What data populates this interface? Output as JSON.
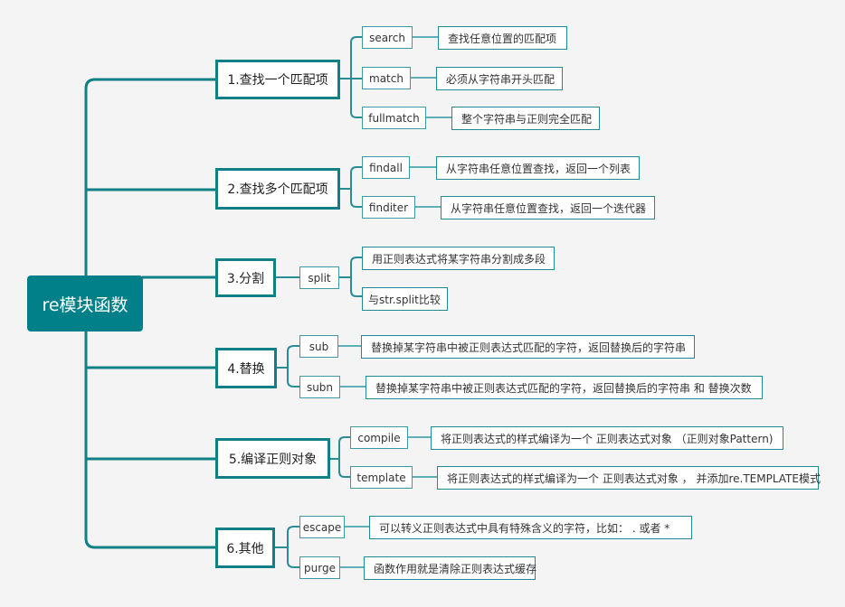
{
  "title": "re模块函数",
  "colors": {
    "primary": "#01808a",
    "line": "#117f86",
    "background": "#f4f4f4"
  },
  "branches": [
    {
      "label": "1.查找一个匹配项",
      "children": [
        {
          "label": "search",
          "desc": [
            "查找任意位置的匹配项"
          ]
        },
        {
          "label": "match",
          "desc": [
            "必须从字符串开头匹配"
          ]
        },
        {
          "label": "fullmatch",
          "desc": [
            "整个字符串与正则完全匹配"
          ]
        }
      ]
    },
    {
      "label": "2.查找多个匹配项",
      "children": [
        {
          "label": "findall",
          "desc": [
            "从字符串任意位置查找，返回一个列表"
          ]
        },
        {
          "label": "finditer",
          "desc": [
            "从字符串任意位置查找，返回一个迭代器"
          ]
        }
      ]
    },
    {
      "label": "3.分割",
      "children": [
        {
          "label": "split",
          "desc": [
            "用正则表达式将某字符串分割成多段",
            "与str.split比较"
          ]
        }
      ]
    },
    {
      "label": "4.替换",
      "children": [
        {
          "label": "sub",
          "desc": [
            "替换掉某字符串中被正则表达式匹配的字符，返回替换后的字符串"
          ]
        },
        {
          "label": "subn",
          "desc": [
            "替换掉某字符串中被正则表达式匹配的字符，返回替换后的字符串 和 替换次数"
          ]
        }
      ]
    },
    {
      "label": "5.编译正则对象",
      "children": [
        {
          "label": "compile",
          "desc": [
            "将正则表达式的样式编译为一个 正则表达式对象 （正则对象Pattern)"
          ]
        },
        {
          "label": "template",
          "desc": [
            "将正则表达式的样式编译为一个 正则表达式对象 ， 并添加re.TEMPLATE模式"
          ]
        }
      ]
    },
    {
      "label": "6.其他",
      "children": [
        {
          "label": "escape",
          "desc": [
            "可以转义正则表达式中具有特殊含义的字符，比如：  .  或者  *"
          ]
        },
        {
          "label": "purge",
          "desc": [
            "函数作用就是清除正则表达式缓存"
          ]
        }
      ]
    }
  ]
}
